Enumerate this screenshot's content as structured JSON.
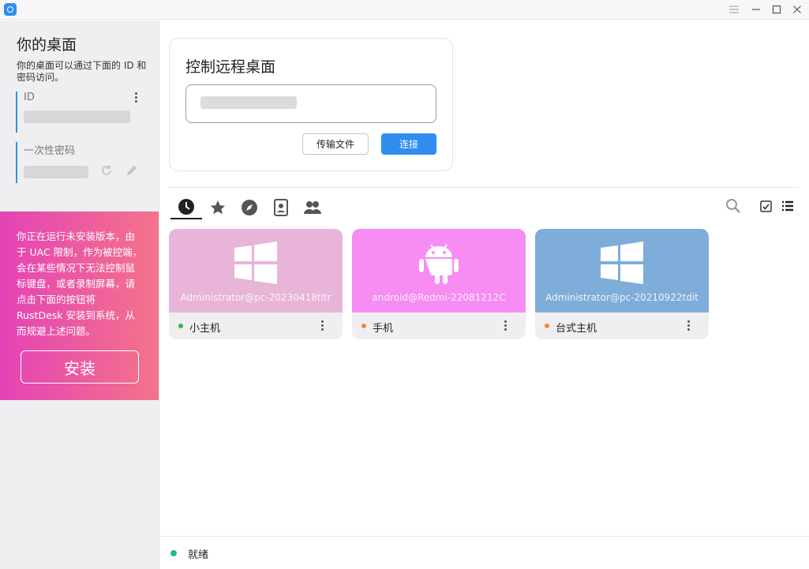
{
  "colors": {
    "accent": "#2f8df0",
    "online": "#3bb54a",
    "offline": "#f08a3c",
    "ready": "#26b893",
    "card_pink": "#e8b4d8",
    "card_magenta": "#f78cf3",
    "card_blue": "#7fadd9"
  },
  "sidebar": {
    "title": "你的桌面",
    "description": "你的桌面可以通过下面的 ID 和密码访问。",
    "id_label": "ID",
    "password_label": "一次性密码",
    "warning": "你正在运行未安装版本，由于 UAC 限制，作为被控端，会在某些情况下无法控制鼠标键盘，或者录制屏幕，请点击下面的按钮将 RustDesk 安装到系统，从而规避上述问题。",
    "install_label": "安装"
  },
  "connect": {
    "title": "控制远程桌面",
    "transfer_label": "传输文件",
    "connect_label": "连接"
  },
  "tabs": [
    {
      "name": "recent",
      "icon": "clock-icon"
    },
    {
      "name": "favorites",
      "icon": "star-icon"
    },
    {
      "name": "discovered",
      "icon": "compass-icon"
    },
    {
      "name": "address-book",
      "icon": "address-book-icon"
    },
    {
      "name": "group",
      "icon": "people-icon"
    }
  ],
  "peers": [
    {
      "host": "Administrator@pc-20230418tltr",
      "name": "小主机",
      "status": "online",
      "os": "windows-icon"
    },
    {
      "host": "android@Redmi-22081212C",
      "name": "手机",
      "status": "offline",
      "os": "android-icon"
    },
    {
      "host": "Administrator@pc-20210922tdit",
      "name": "台式主机",
      "status": "offline",
      "os": "windows-icon"
    }
  ],
  "status": {
    "text": "就绪"
  }
}
